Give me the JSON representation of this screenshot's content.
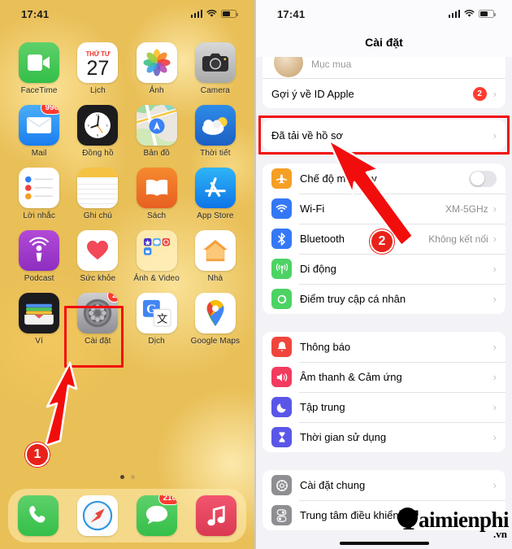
{
  "left_phone": {
    "status": {
      "time": "17:41",
      "signal_icon": "cellular-bars-icon",
      "wifi_icon": "wifi-icon",
      "battery_icon": "battery-icon"
    },
    "apps": [
      {
        "label": "FaceTime",
        "icon": "facetime-icon",
        "badge": null
      },
      {
        "label": "Lịch",
        "icon": "calendar-icon",
        "badge": null,
        "cal_weekday": "THỨ TƯ",
        "cal_day": "27"
      },
      {
        "label": "Ảnh",
        "icon": "photos-icon",
        "badge": null
      },
      {
        "label": "Camera",
        "icon": "camera-icon",
        "badge": null
      },
      {
        "label": "Mail",
        "icon": "mail-icon",
        "badge": "990"
      },
      {
        "label": "Đồng hồ",
        "icon": "clock-icon",
        "badge": null
      },
      {
        "label": "Bản đồ",
        "icon": "maps-icon",
        "badge": null
      },
      {
        "label": "Thời tiết",
        "icon": "weather-icon",
        "badge": null
      },
      {
        "label": "Lời nhắc",
        "icon": "reminders-icon",
        "badge": null
      },
      {
        "label": "Ghi chú",
        "icon": "notes-icon",
        "badge": null
      },
      {
        "label": "Sách",
        "icon": "books-icon",
        "badge": null
      },
      {
        "label": "App Store",
        "icon": "appstore-icon",
        "badge": null
      },
      {
        "label": "Podcast",
        "icon": "podcasts-icon",
        "badge": null
      },
      {
        "label": "Sức khỏe",
        "icon": "health-icon",
        "badge": null
      },
      {
        "label": "Ảnh & Video",
        "icon": "folder-icon",
        "badge": null
      },
      {
        "label": "Nhà",
        "icon": "home-icon",
        "badge": null
      },
      {
        "label": "Ví",
        "icon": "wallet-icon",
        "badge": null
      },
      {
        "label": "Cài đặt",
        "icon": "settings-gear-icon",
        "badge": "2"
      },
      {
        "label": "Dịch",
        "icon": "google-translate-icon",
        "badge": null
      },
      {
        "label": "Google Maps",
        "icon": "google-maps-icon",
        "badge": null
      }
    ],
    "dock": [
      {
        "label": "Điện thoại",
        "icon": "phone-icon",
        "badge": null
      },
      {
        "label": "Safari",
        "icon": "safari-icon",
        "badge": null
      },
      {
        "label": "Tin nhắn",
        "icon": "messages-icon",
        "badge": "210"
      },
      {
        "label": "Nhạc",
        "icon": "music-icon",
        "badge": null
      }
    ],
    "page_dots": {
      "total": 2,
      "active": 1
    },
    "annotation": {
      "step_number": "1",
      "highlight_target": "Cài đặt",
      "arrow": "red-arrow-icon"
    }
  },
  "right_phone": {
    "status": {
      "time": "17:41",
      "signal_icon": "cellular-bars-icon",
      "wifi_icon": "wifi-icon",
      "battery_icon": "battery-icon"
    },
    "nav_title": "Cài đặt",
    "partial_row": {
      "label": "Mục mua",
      "avatar": "user-avatar"
    },
    "apple_id_row": {
      "label": "Gợi ý về ID Apple",
      "badge": "2",
      "chevron": "chevron-right-icon"
    },
    "highlighted_row": {
      "label": "Đã tải về hồ sơ",
      "chevron": "chevron-right-icon"
    },
    "group_connectivity": [
      {
        "label": "Chế độ máy bay",
        "icon": "airplane-icon",
        "icon_color": "#f59f24",
        "control": "toggle",
        "value": ""
      },
      {
        "label": "Wi-Fi",
        "icon": "wifi-icon",
        "icon_color": "#3478f6",
        "control": "chevron",
        "value": "XM-5GHz"
      },
      {
        "label": "Bluetooth",
        "icon": "bluetooth-icon",
        "icon_color": "#3478f6",
        "control": "chevron",
        "value": "Không kết nối"
      },
      {
        "label": "Di động",
        "icon": "cellular-icon",
        "icon_color": "#4cd363",
        "control": "chevron",
        "value": ""
      },
      {
        "label": "Điểm truy cập cá nhân",
        "icon": "hotspot-icon",
        "icon_color": "#4cd363",
        "control": "chevron",
        "value": ""
      }
    ],
    "group_notifications": [
      {
        "label": "Thông báo",
        "icon": "bell-icon",
        "icon_color": "#f0453c",
        "control": "chevron",
        "value": ""
      },
      {
        "label": "Âm thanh & Cảm ứng",
        "icon": "speaker-icon",
        "icon_color": "#f23b5e",
        "control": "chevron",
        "value": ""
      },
      {
        "label": "Tập trung",
        "icon": "moon-icon",
        "icon_color": "#5a56e8",
        "control": "chevron",
        "value": ""
      },
      {
        "label": "Thời gian sử dụng",
        "icon": "hourglass-icon",
        "icon_color": "#5a56e8",
        "control": "chevron",
        "value": ""
      }
    ],
    "group_general": [
      {
        "label": "Cài đặt chung",
        "icon": "gear-icon",
        "icon_color": "#8e8e93",
        "control": "chevron",
        "value": ""
      },
      {
        "label": "Trung tâm điều khiển",
        "icon": "control-center-icon",
        "icon_color": "#8e8e93",
        "control": "chevron",
        "value": ""
      }
    ],
    "annotation": {
      "step_number": "2",
      "arrow": "red-arrow-icon"
    }
  },
  "watermark": {
    "main": "aimienphi",
    "initial": "T",
    "suffix": ".vn"
  },
  "colors": {
    "wallpaper": "#e9bf57",
    "annotation_red": "#f20d0d",
    "badge_red": "#ff3b30",
    "settings_bg": "#f2f2f7"
  }
}
